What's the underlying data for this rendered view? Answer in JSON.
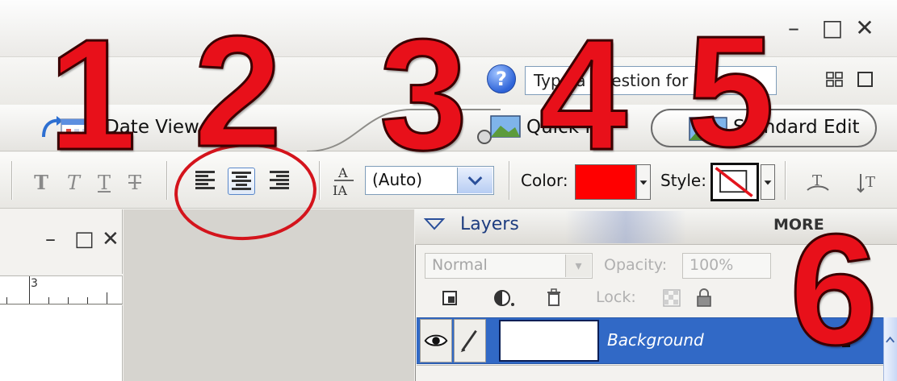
{
  "window_controls": {
    "minimize": "–",
    "maximize": "□",
    "close": "✕"
  },
  "help": {
    "icon": "?",
    "search_value": "Type a question for help"
  },
  "mode_bar": {
    "date_view_label": "Date View",
    "quick_label": "Quick Fix",
    "standard_edit_label": "Standard Edit"
  },
  "format_toolbar": {
    "text_styles": [
      "T",
      "T",
      "T",
      "T"
    ],
    "leading_value": "(Auto)",
    "color_label": "Color:",
    "style_label": "Style:",
    "text_color": "#ff0000"
  },
  "document_window": {
    "controls": {
      "minimize": "–",
      "maximize": "□",
      "close": "✕"
    },
    "ruler_mark": "3"
  },
  "layers_panel": {
    "title": "Layers",
    "more_label": "MORE",
    "blend_mode": "Normal",
    "opacity_label": "Opacity:",
    "opacity_value": "100%",
    "lock_label": "Lock:",
    "layers": [
      {
        "name": "Background",
        "selected": true
      }
    ]
  },
  "callouts": [
    "1",
    "2",
    "3",
    "4",
    "5",
    "6"
  ],
  "colors": {
    "accent": "#3169c6",
    "callout": "#e8101a"
  }
}
